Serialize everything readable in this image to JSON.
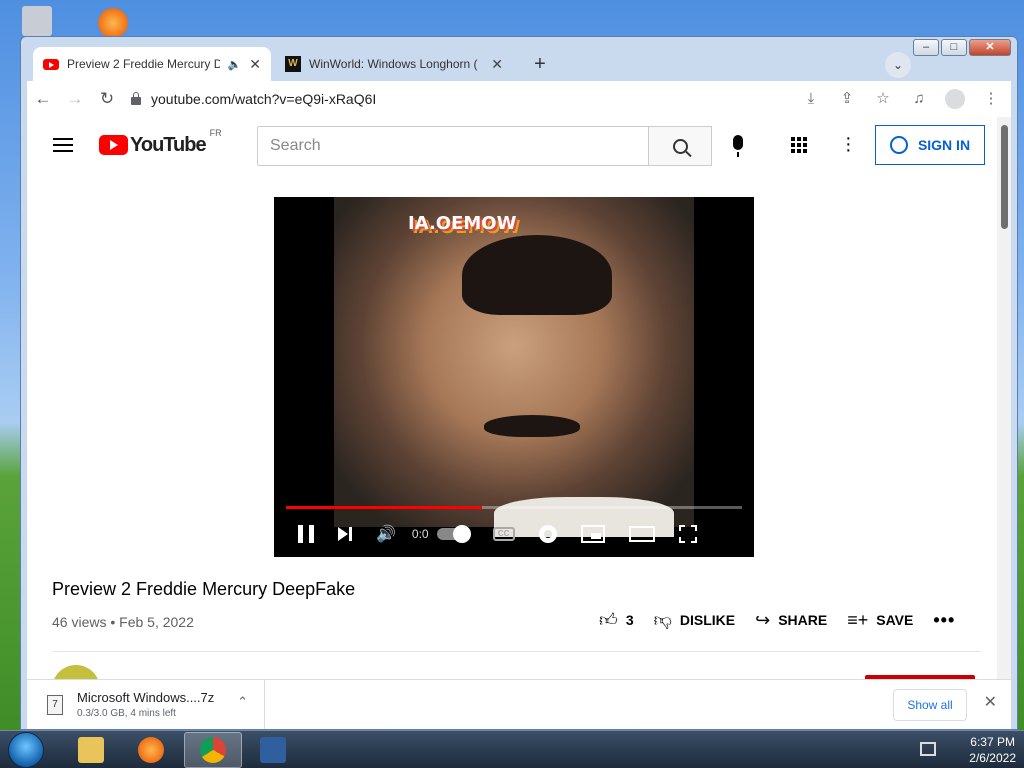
{
  "browser": {
    "tabs": [
      {
        "title": "Preview 2 Freddie Mercury De",
        "icon": "youtube-favicon",
        "audio": true,
        "active": true
      },
      {
        "title": "WinWorld: Windows Longhorn (",
        "icon": "winworld-favicon",
        "active": false
      }
    ],
    "url": "youtube.com/watch?v=eQ9i-xRaQ6I"
  },
  "youtube": {
    "logo_text": "YouTube",
    "country_code": "FR",
    "search_placeholder": "Search",
    "signin_label": "SIGN IN"
  },
  "video": {
    "watermark": "IA.OEMOW",
    "time": "0:0",
    "progress_fraction": 0.43,
    "title": "Preview 2 Freddie Mercury DeepFake",
    "meta": "46 views • Feb 5, 2022",
    "like_count": "3",
    "dislike_label": "DISLIKE",
    "share_label": "SHARE",
    "save_label": "SAVE"
  },
  "downloads": {
    "file_name": "Microsoft Windows....7z",
    "status": "0.3/3.0 GB, 4 mins left",
    "show_all_label": "Show all"
  },
  "taskbar": {
    "time": "6:37 PM",
    "date": "2/6/2022",
    "apps": [
      "file-explorer",
      "firefox",
      "chrome",
      "virtualbox"
    ]
  },
  "colors": {
    "youtube_red": "#ff0000",
    "link_blue": "#065fd4",
    "chrome_blue": "#1a73e8"
  }
}
